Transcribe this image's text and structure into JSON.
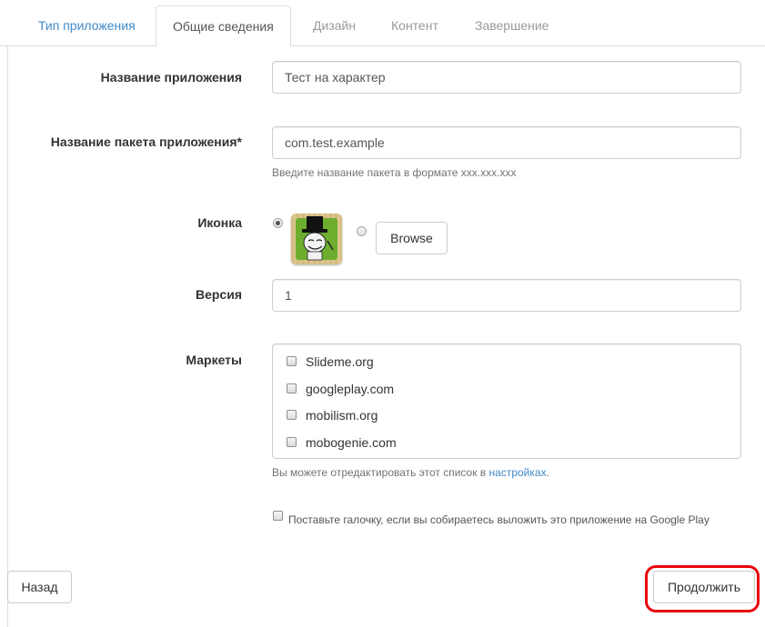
{
  "tabs": [
    {
      "label": "Тип приложения",
      "state": "link"
    },
    {
      "label": "Общие сведения",
      "state": "active"
    },
    {
      "label": "Дизайн",
      "state": "disabled"
    },
    {
      "label": "Контент",
      "state": "disabled"
    },
    {
      "label": "Завершение",
      "state": "disabled"
    }
  ],
  "form": {
    "app_name": {
      "label": "Название приложения",
      "value": "Тест на характер"
    },
    "package": {
      "label": "Название пакета приложения*",
      "value": "com.test.example",
      "help": "Введите название пакета в формате xxx.xxx.xxx"
    },
    "icon": {
      "label": "Иконка",
      "browse_label": "Browse",
      "icon_name": "trollface-gentleman-icon",
      "selected": "default"
    },
    "version": {
      "label": "Версия",
      "value": "1"
    },
    "markets": {
      "label": "Маркеты",
      "items": [
        "Slideme.org",
        "googleplay.com",
        "mobilism.org",
        "mobogenie.com"
      ],
      "help_prefix": "Вы можете отредактировать этот список в",
      "help_link": "настройках",
      "help_suffix": "."
    },
    "google_play_checkbox": {
      "label": "Поставьте галочку, если вы собираетесь выложить это приложение на Google Play",
      "checked": false
    }
  },
  "footer": {
    "back_label": "Назад",
    "next_label": "Продолжить"
  },
  "colors": {
    "accent": "#428bca",
    "highlight": "#e8000b",
    "border": "#cccccc"
  }
}
